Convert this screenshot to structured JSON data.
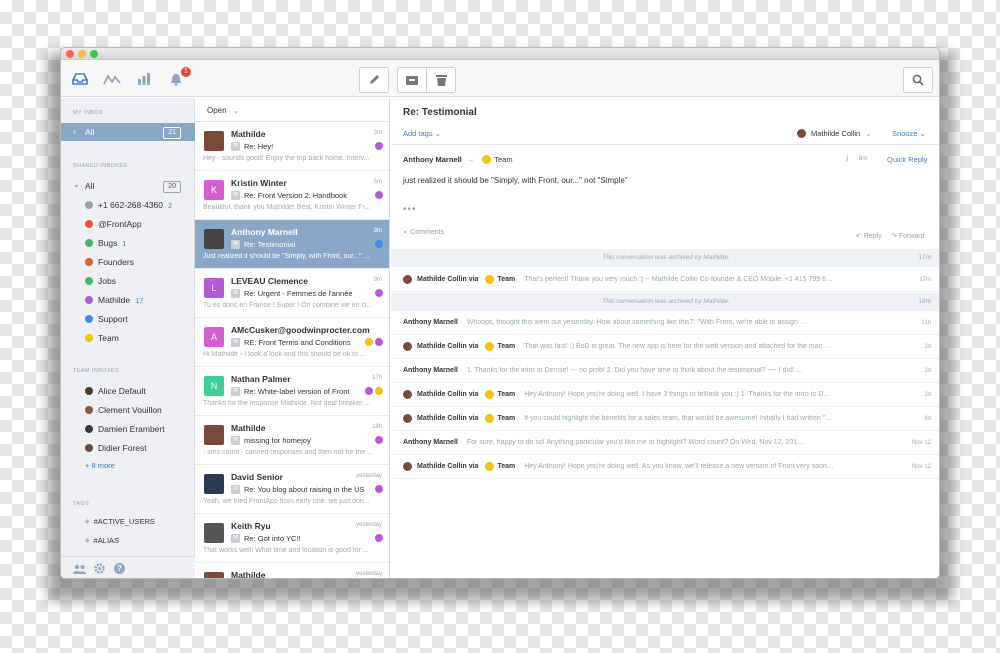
{
  "toolbar": {
    "notif_count": "1"
  },
  "sidebar": {
    "my_inbox": "MY INBOX",
    "all": "All",
    "all_count": "21",
    "shared_inboxes": "SHARED INBOXES",
    "shared_all": "All",
    "shared_all_count": "20",
    "shared": [
      {
        "label": "+1 662-268-4360",
        "count": "2",
        "color": "#9aa3ad"
      },
      {
        "label": "@FrontApp",
        "count": "",
        "color": "#e8543c"
      },
      {
        "label": "Bugs",
        "count": "1",
        "color": "#3dbb6b"
      },
      {
        "label": "Founders",
        "count": "",
        "color": "#e8543c"
      },
      {
        "label": "Jobs",
        "count": "",
        "color": "#3dbb6b"
      },
      {
        "label": "Mathilde",
        "count": "17",
        "color": "#b45ad8"
      },
      {
        "label": "Support",
        "count": "",
        "color": "#3d8ee8"
      },
      {
        "label": "Team",
        "count": "",
        "color": "#f1c40f"
      }
    ],
    "team_inboxes": "TEAM INBOXES",
    "team": [
      {
        "label": "Alice Default"
      },
      {
        "label": "Clement Vouillon"
      },
      {
        "label": "Damien Erambert"
      },
      {
        "label": "Didier Forest"
      }
    ],
    "more": "+ 8 more",
    "tags": "TAGS",
    "tag_items": [
      "#ACTIVE_USERS",
      "#ALIAS"
    ]
  },
  "list": {
    "filter": "Open",
    "items": [
      {
        "name": "Mathilde",
        "subject": "Re: Hey!",
        "preview": "Hey - sounds good! Enjoy the trip back home. Interv...",
        "time": "3m",
        "initial": "",
        "color": "#7a4a3a"
      },
      {
        "name": "Kristin Winter",
        "subject": "Re: Front Version 2: Handbook",
        "preview": "Beautiful, thank you Mathilde! Best, Kristin Winter Fr...",
        "time": "5m",
        "initial": "K",
        "color": "#d65fd0"
      },
      {
        "name": "Anthony Marnell",
        "subject": "Re: Testimonial",
        "preview": "Just realized it should be \"Simply, with Front, our...\" ...",
        "time": "9m",
        "initial": "",
        "color": "#444"
      },
      {
        "name": "LEVEAU Clemence",
        "subject": "Re: Urgent - Femmes de l'année",
        "preview": "Tu es donc en France ! Super ! On combine vie en cl...",
        "time": "9m",
        "initial": "L",
        "color": "#b45ad8"
      },
      {
        "name": "AMcCusker@goodwinprocter.com",
        "subject": "RE: Front Terms and Conditions",
        "preview": "Hi Mathilde - I took a look and this should be ok to ...",
        "time": "",
        "initial": "A",
        "color": "#d65fd0"
      },
      {
        "name": "Nathan Palmer",
        "subject": "Re: White-label version of Front",
        "preview": "Thanks for the response Mathilde. Not deal breaker ...",
        "time": "17h",
        "initial": "N",
        "color": "#3dcf9a"
      },
      {
        "name": "Mathilde",
        "subject": "missing for homejoy",
        "preview": "- sms count - canned responses and then not for the ...",
        "time": "18h",
        "initial": "",
        "color": "#7a4a3a"
      },
      {
        "name": "David Senior",
        "subject": "Re: You blog about raising in the US",
        "preview": "Yeah, we tried FrontApp from early one. we just don...",
        "time": "yesterday",
        "initial": "",
        "color": "#2e3a55"
      },
      {
        "name": "Keith Ryu",
        "subject": "Re: Got into YC!!",
        "preview": "That works well! What time and location is good for ...",
        "time": "yesterday",
        "initial": "",
        "color": "#555"
      },
      {
        "name": "Mathilde",
        "subject": "",
        "preview": "",
        "time": "yesterday",
        "initial": "",
        "color": "#7a4a3a"
      }
    ]
  },
  "main": {
    "title": "Re: Testimonial",
    "add_tags": "Add tags",
    "assignee": "Mathilde Collin",
    "snooze": "Snooze",
    "from": "Anthony Marnell",
    "to": "Team",
    "time": "8m",
    "quick_reply": "Quick Reply",
    "body": "just realized it should be \"Simply, with Front, our...\" not \"Simple\"",
    "comments": "Comments",
    "reply": "Reply",
    "forward": "Forward",
    "archived1": "This conversation was archived by Mathilde.",
    "archived1_time": "17m",
    "archived2": "This conversation was archived by Mathilde.",
    "archived2_time": "18m",
    "thread": [
      {
        "name": "Mathilde Collin via",
        "team": "Team",
        "text": "That's perfect! Thank you very much :) -- Mathilde Collin Co-founder & CEO Mobile: +1 415 799 6253 Sent wi...",
        "time": "17m",
        "mine": true
      },
      {
        "name": "Anthony Marnell",
        "team": "",
        "text": "Whoops, thought this went out yesterday. How about something like this?: \"With Front, we're able to assign inbound sales leads, colla...",
        "time": "11h",
        "mine": false
      },
      {
        "name": "Mathilde Collin via",
        "team": "Team",
        "text": "That was fast! :) EoD is great. The new app is here for the web version and attached for the mac version. I look forwar...",
        "time": "2d",
        "mine": true
      },
      {
        "name": "Anthony Marnell",
        "team": "",
        "text": "1. Thanks for the intro to Denise! --- no prob! 2. Did you have time to think about the testimonial? ---- I did! will try to get this to you be ...",
        "time": "2d",
        "mine": false
      },
      {
        "name": "Mathilde Collin via",
        "team": "Team",
        "text": "Hey Anthony! Hope you're doing well. I have 3 things to tell/ask you :) 1. Thanks for the intro to Denise! 2. Did you ha...",
        "time": "2d",
        "mine": true
      },
      {
        "name": "Mathilde Collin via",
        "team": "Team",
        "text": "If you could highlight the benefits for a sales team, that would be awesome! Initially I had written \"Assign incoming lea...",
        "time": "6d",
        "mine": true
      },
      {
        "name": "Anthony Marnell",
        "team": "",
        "text": "For sure, happy to do so! Anything particular you'd like me to highlight? Word count? On Wed, Nov 12, 2014 at 5:59 AM, < team@fr...",
        "time": "Nov 12",
        "mine": false
      },
      {
        "name": "Mathilde Collin via",
        "team": "Team",
        "text": "Hey Anthony! Hope you're doing well. As you know, we'll release a new version of Front very soon. And we will ha...",
        "time": "Nov 12",
        "mine": true
      }
    ]
  }
}
